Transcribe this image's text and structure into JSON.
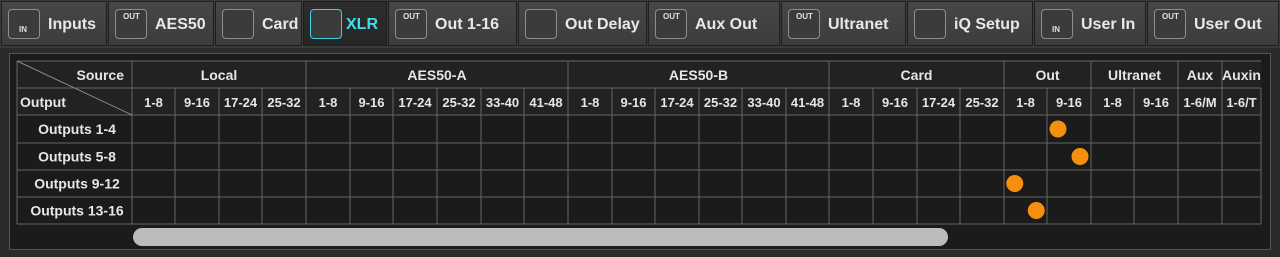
{
  "tabs": [
    {
      "label": "Inputs",
      "icon": "input-icon",
      "icon_text": "IN",
      "active": false
    },
    {
      "label": "AES50",
      "icon": "output-icon",
      "icon_text": "OUT",
      "active": false
    },
    {
      "label": "Card",
      "icon": "card-icon",
      "icon_text": "",
      "active": false
    },
    {
      "label": "XLR",
      "icon": "xlr-connector-icon",
      "icon_text": "",
      "active": true
    },
    {
      "label": "Out 1-16",
      "icon": "output-icon",
      "icon_text": "OUT",
      "active": false
    },
    {
      "label": "Out Delay",
      "icon": "delta-t-icon",
      "icon_text": "",
      "active": false
    },
    {
      "label": "Aux Out",
      "icon": "output-icon",
      "icon_text": "OUT",
      "active": false
    },
    {
      "label": "Ultranet",
      "icon": "output-icon",
      "icon_text": "OUT",
      "active": false
    },
    {
      "label": "iQ Setup",
      "icon": "speaker-icon",
      "icon_text": "",
      "active": false
    },
    {
      "label": "User In",
      "icon": "input-icon",
      "icon_text": "IN",
      "active": false
    },
    {
      "label": "User Out",
      "icon": "output-icon",
      "icon_text": "OUT",
      "active": false
    }
  ],
  "matrix": {
    "corner_source": "Source",
    "corner_output": "Output",
    "groups": [
      {
        "label": "Local",
        "columns": [
          "1-8",
          "9-16",
          "17-24",
          "25-32"
        ]
      },
      {
        "label": "AES50-A",
        "columns": [
          "1-8",
          "9-16",
          "17-24",
          "25-32",
          "33-40",
          "41-48"
        ]
      },
      {
        "label": "AES50-B",
        "columns": [
          "1-8",
          "9-16",
          "17-24",
          "25-32",
          "33-40",
          "41-48"
        ]
      },
      {
        "label": "Card",
        "columns": [
          "1-8",
          "9-16",
          "17-24",
          "25-32"
        ]
      },
      {
        "label": "Out",
        "columns": [
          "1-8",
          "9-16"
        ]
      },
      {
        "label": "Ultranet",
        "columns": [
          "1-8",
          "9-16"
        ]
      },
      {
        "label": "Aux",
        "columns": [
          "1-6/M"
        ]
      },
      {
        "label": "Auxin",
        "columns": [
          "1-6/T"
        ]
      }
    ],
    "rows": [
      "Outputs 1-4",
      "Outputs 5-8",
      "Outputs 9-12",
      "Outputs 13-16"
    ],
    "selections": [
      {
        "row": "Outputs 1-4",
        "source": "Out 9-16"
      },
      {
        "row": "Outputs 5-8",
        "source": "Out 9-16"
      },
      {
        "row": "Outputs 9-12",
        "source": "Out 1-8"
      },
      {
        "row": "Outputs 13-16",
        "source": "Out 1-8"
      }
    ],
    "dot_color": "#f5900f"
  }
}
